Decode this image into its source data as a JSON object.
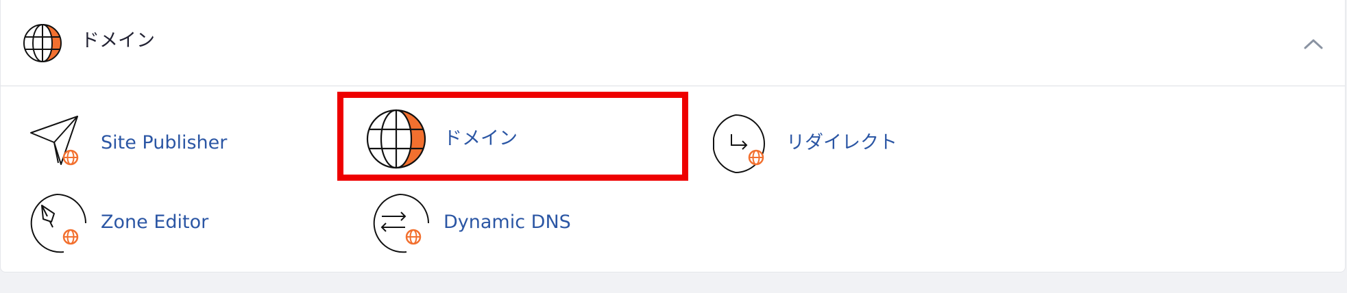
{
  "section": {
    "title": "ドメイン",
    "icon": "globe-icon",
    "collapse_icon": "chevron-up-icon"
  },
  "items": [
    {
      "label": "Site Publisher",
      "icon": "paper-plane-globe-icon"
    },
    {
      "label": "ドメイン",
      "icon": "globe-icon"
    },
    {
      "label": "リダイレクト",
      "icon": "redirect-arrow-globe-icon"
    },
    {
      "label": "Zone Editor",
      "icon": "pen-nib-globe-icon"
    },
    {
      "label": "Dynamic DNS",
      "icon": "swap-arrows-globe-icon"
    }
  ],
  "colors": {
    "link": "#2b56a4",
    "accent": "#f2702f",
    "highlight": "#ee0000"
  }
}
